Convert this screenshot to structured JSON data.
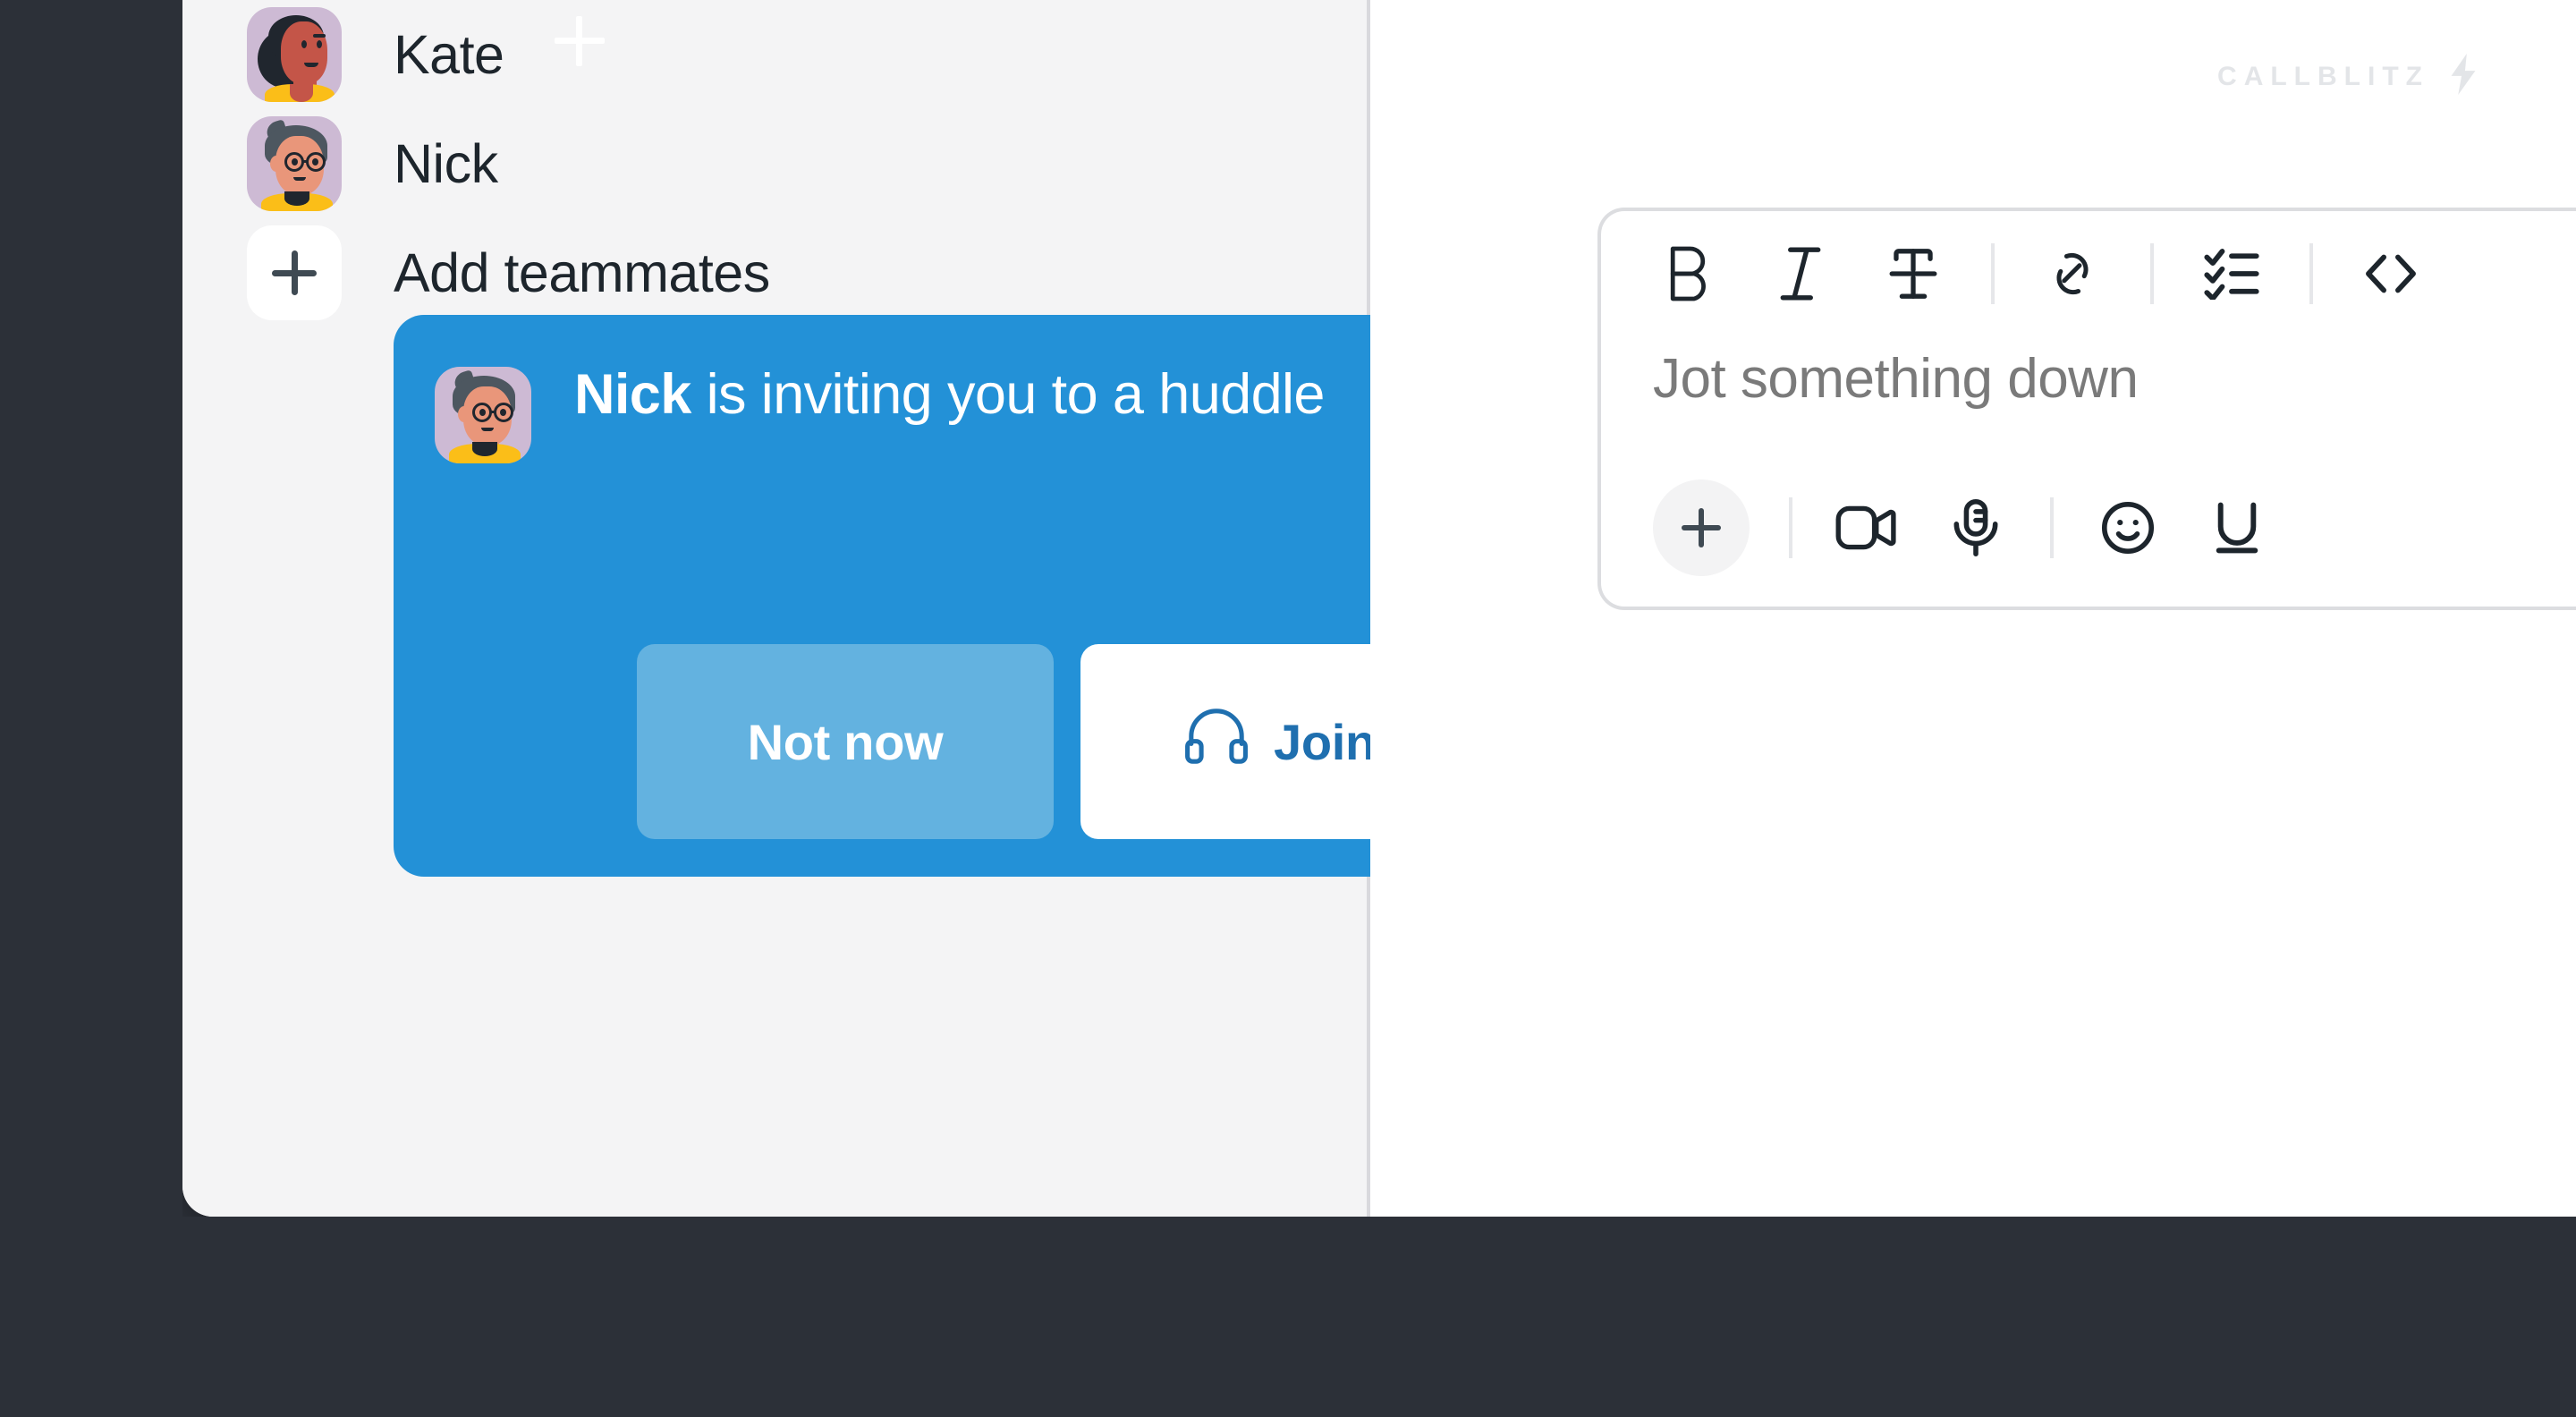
{
  "brand": {
    "name": "CALLBLITZ",
    "logo_icon": "lightning-bolt-icon",
    "accent_color": "#2391D7",
    "watermark_color": "#E3E5E8"
  },
  "sidebar": {
    "members": [
      {
        "name": "Kate",
        "avatar_icon": "avatar-kate"
      },
      {
        "name": "Nick",
        "avatar_icon": "avatar-nick"
      }
    ],
    "add_teammates": {
      "label": "Add teammates",
      "icon": "plus-icon"
    }
  },
  "huddle_invite": {
    "avatar_icon": "avatar-nick",
    "inviter": "Nick",
    "message_rest": " is inviting you to a huddle",
    "full_message": "Nick is inviting you to a huddle",
    "decline_label": "Not now",
    "accept_label": "Join",
    "accept_icon": "headphones-icon",
    "card_color": "#2391D7",
    "decline_button_color": "#63B2E0",
    "accept_text_color": "#1F6FAF"
  },
  "composer": {
    "placeholder": "Jot something down",
    "toolbar": [
      {
        "name": "bold-icon",
        "label": "B"
      },
      {
        "name": "italic-icon",
        "label": "I"
      },
      {
        "name": "strikethrough-icon",
        "label": "S"
      },
      {
        "name": "link-icon",
        "label": "Link"
      },
      {
        "name": "checklist-icon",
        "label": "Checklist"
      },
      {
        "name": "code-icon",
        "label": "Code"
      }
    ],
    "actions": [
      {
        "name": "add-icon",
        "label": "Add"
      },
      {
        "name": "video-icon",
        "label": "Video"
      },
      {
        "name": "microphone-icon",
        "label": "Audio"
      },
      {
        "name": "emoji-icon",
        "label": "Emoji"
      },
      {
        "name": "underline-icon",
        "label": "Underline"
      }
    ]
  },
  "cursor": {
    "icon": "crosshair-plus-cursor"
  }
}
